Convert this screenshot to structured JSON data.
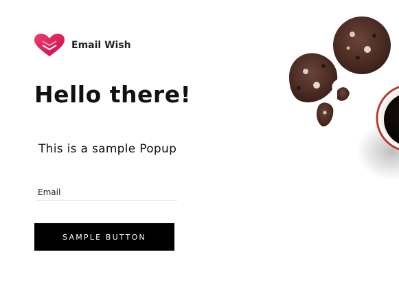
{
  "brand": {
    "name": "Email Wish",
    "logo_icon": "heart-envelope-icon",
    "logo_colors": [
      "#e8195c",
      "#b3124a"
    ]
  },
  "popup": {
    "headline": "Hello there!",
    "subtitle": "This is a sample Popup",
    "email_placeholder": "Email",
    "email_value": "",
    "button_label": "SAMPLE BUTTON",
    "button_color": "#000000"
  },
  "decor": {
    "image_icon": "cookies-and-coffee-image"
  }
}
